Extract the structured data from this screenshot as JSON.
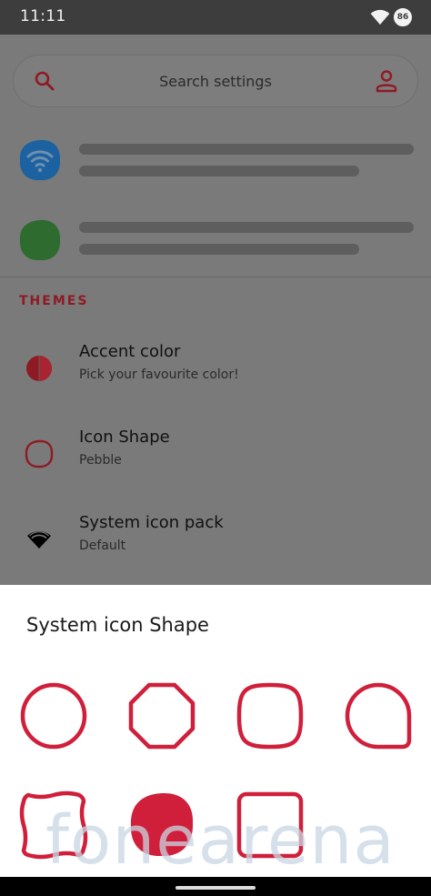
{
  "status_bar": {
    "time": "11:11",
    "battery": "86"
  },
  "search": {
    "placeholder": "Search settings"
  },
  "themes_section": {
    "label": "THEMES",
    "items": [
      {
        "title": "Accent color",
        "subtitle": "Pick your favourite color!"
      },
      {
        "title": "Icon Shape",
        "subtitle": "Pebble"
      },
      {
        "title": "System icon pack",
        "subtitle": "Default"
      }
    ]
  },
  "sheet": {
    "title": "System icon Shape",
    "shapes": [
      "circle-shape",
      "octagon-shape",
      "squircle-shape",
      "teardrop-shape",
      "wavy-square-shape",
      "pebble-shape-selected",
      "square-shape"
    ]
  },
  "watermark": "fonearena",
  "colors": {
    "accent": "#d01f3a",
    "wifi_blob": "#1c62a0",
    "green_blob": "#2d6b2f",
    "status_bar": "#3d3d3d",
    "scrim": "#7a7a7a"
  }
}
